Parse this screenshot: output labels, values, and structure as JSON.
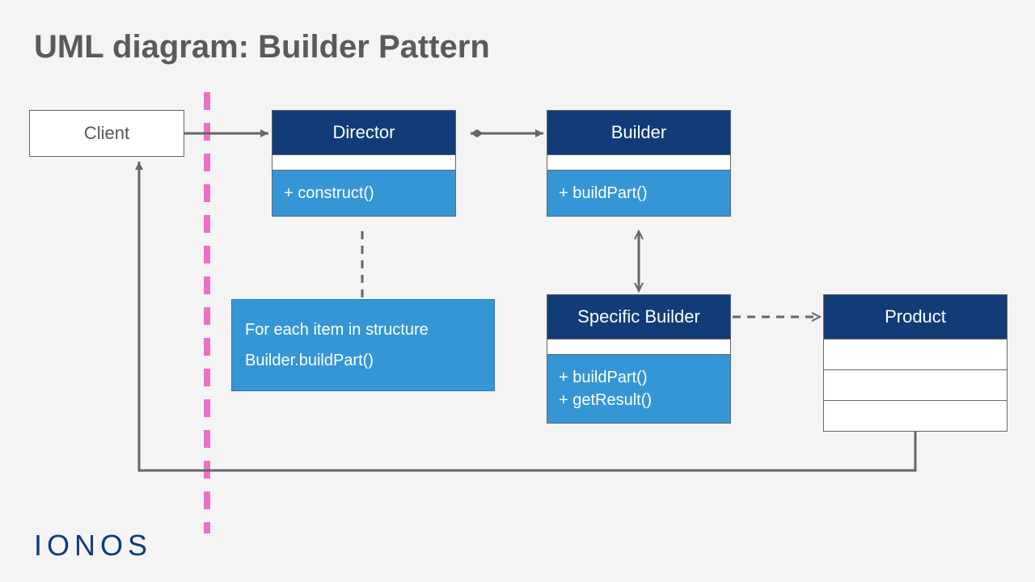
{
  "title": "UML diagram: Builder Pattern",
  "client": {
    "label": "Client"
  },
  "director": {
    "name": "Director",
    "method": "+ construct()"
  },
  "builder": {
    "name": "Builder",
    "method": "+ buildPart()"
  },
  "specific": {
    "name": "Specific Builder",
    "method1": "+ buildPart()",
    "method2": "+ getResult()"
  },
  "product": {
    "name": "Product"
  },
  "note": {
    "line1": "For each item in structure",
    "line2": "Builder.buildPart()"
  },
  "logo": "IONOS"
}
